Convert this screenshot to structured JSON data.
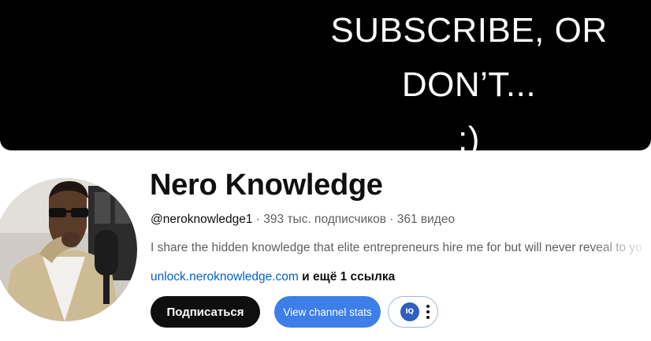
{
  "banner": {
    "lines": [
      "SUBSCRIBE, OR",
      "DON’T...",
      ";)"
    ]
  },
  "channel": {
    "name": "Nero Knowledge",
    "handle": "@neroknowledge1",
    "separator": " · ",
    "subscribers": "393 тыс. подписчиков",
    "videos": "361 видео",
    "description": "I share the hidden knowledge that elite entrepreneurs hire me for but will never reveal to yo",
    "link": "unlock.neroknowledge.com",
    "more_links": "и ещё 1 ссылка"
  },
  "buttons": {
    "subscribe": "Подписаться",
    "channel_stats": "View channel stats",
    "extension_badge": "IQ"
  },
  "colors": {
    "banner_bg": "#000000",
    "subscribe_bg": "#0f0f0f",
    "stats_bg": "#3d7ee9",
    "link": "#065fd4"
  }
}
